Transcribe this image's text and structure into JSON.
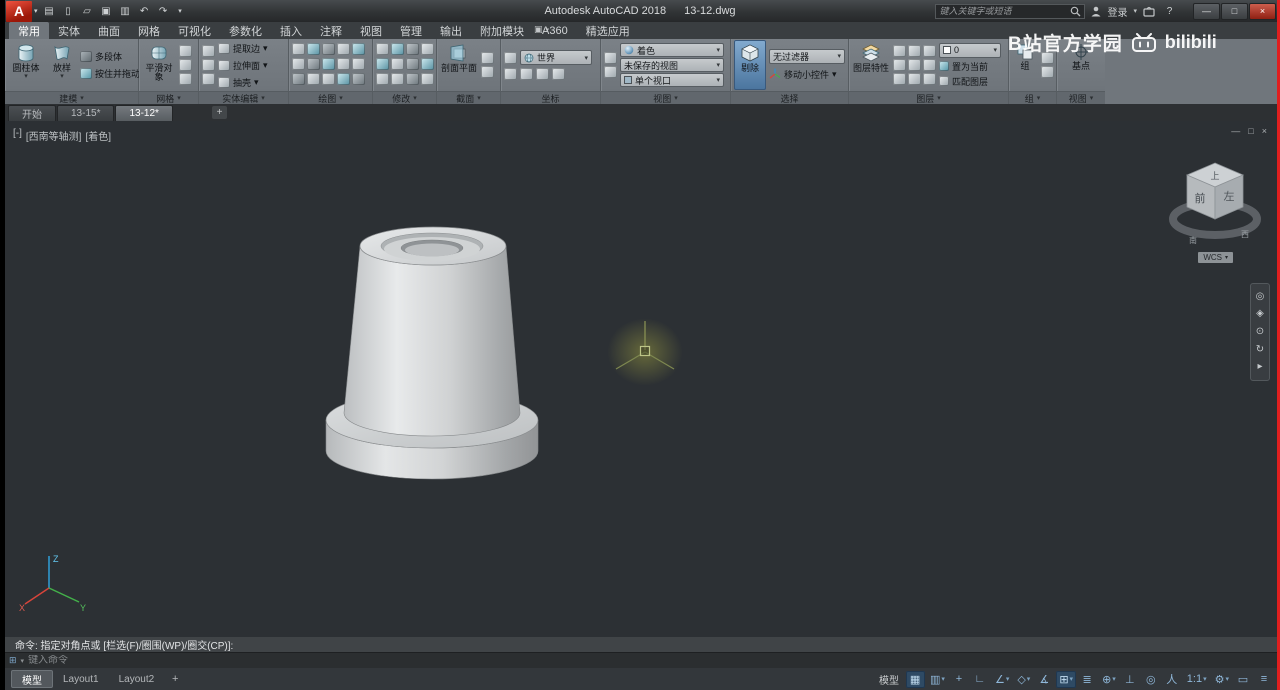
{
  "ui": {
    "flyout_arrow": "▾",
    "logo_letter": "A"
  },
  "title_bar": {
    "app_title": "Autodesk AutoCAD 2018",
    "doc_title": "13-12.dwg",
    "qat": [
      {
        "name": "workspace",
        "glyph": "▤"
      },
      {
        "name": "new-file",
        "glyph": "▯"
      },
      {
        "name": "open-file",
        "glyph": "▱"
      },
      {
        "name": "save-file",
        "glyph": "▣"
      },
      {
        "name": "plot",
        "glyph": "▥"
      },
      {
        "name": "undo",
        "glyph": "↶"
      },
      {
        "name": "redo",
        "glyph": "↷"
      }
    ],
    "search_placeholder": "键入关键字或短语",
    "signin_label": "登录",
    "help_label": "?",
    "window": {
      "minimize": "—",
      "restore": "□",
      "close": "×"
    }
  },
  "watermark": {
    "text": "B站官方学园",
    "brand": "bilibili"
  },
  "ribbon": {
    "toggle_glyph": "▣",
    "tabs": [
      {
        "label": "常用",
        "active": true
      },
      {
        "label": "实体"
      },
      {
        "label": "曲面"
      },
      {
        "label": "网格"
      },
      {
        "label": "可视化"
      },
      {
        "label": "参数化"
      },
      {
        "label": "插入"
      },
      {
        "label": "注释"
      },
      {
        "label": "视图"
      },
      {
        "label": "管理"
      },
      {
        "label": "输出"
      },
      {
        "label": "附加模块"
      },
      {
        "label": "A360"
      },
      {
        "label": "精选应用"
      }
    ],
    "panels": {
      "modeling": {
        "label": "建模",
        "cylinder": "圆柱体",
        "loft": "放样",
        "polysolid": "多段体",
        "presspull": "按住并拖动"
      },
      "mesh": {
        "label": "网格",
        "smooth_object": "平滑对象"
      },
      "solid_editing": {
        "label": "实体编辑",
        "rows": [
          {
            "label": "提取边"
          },
          {
            "label": "拉伸面"
          },
          {
            "label": "抽壳"
          }
        ]
      },
      "draw": {
        "label": "绘图",
        "tools": [
          {
            "name": "line"
          },
          {
            "name": "polyline"
          },
          {
            "name": "circle"
          },
          {
            "name": "arc"
          },
          {
            "name": "rectangle"
          },
          {
            "name": "ellipse"
          },
          {
            "name": "hatch"
          },
          {
            "name": "spline"
          },
          {
            "name": "point"
          },
          {
            "name": "region"
          },
          {
            "name": "helix"
          },
          {
            "name": "donut"
          },
          {
            "name": "revision-cloud"
          },
          {
            "name": "construction-line"
          },
          {
            "name": "multiline"
          }
        ]
      },
      "modify": {
        "label": "修改",
        "tools": [
          {
            "name": "move"
          },
          {
            "name": "rotate"
          },
          {
            "name": "trim"
          },
          {
            "name": "copy"
          },
          {
            "name": "mirror"
          },
          {
            "name": "fillet"
          },
          {
            "name": "erase"
          },
          {
            "name": "stretch"
          },
          {
            "name": "scale"
          },
          {
            "name": "array"
          },
          {
            "name": "offset"
          },
          {
            "name": "explode"
          }
        ]
      },
      "section": {
        "label": "截面",
        "section_plane": "剖面平面"
      },
      "coordinates": {
        "label": "坐标",
        "ucs_current": "世界"
      },
      "view_controls": {
        "label": "视图",
        "visual_style": "着色",
        "named_view": "未保存的视图",
        "viewport_config": "单个视口"
      },
      "selection": {
        "label": "选择",
        "culling": "剔除",
        "filter": "无过滤器",
        "gizmo": "移动小控件"
      },
      "layers": {
        "label": "图层",
        "layer_properties": "图层特性",
        "current_layer": "0",
        "make_current": "置为当前",
        "match_layer": "匹配图层"
      },
      "groups": {
        "label": "组",
        "group": "组"
      },
      "view_tail": {
        "label": "视图",
        "base_point": "基点"
      }
    }
  },
  "file_tabs": {
    "tabs": [
      {
        "label": "开始"
      },
      {
        "label": "13-15*"
      },
      {
        "label": "13-12*",
        "active": true
      }
    ],
    "add_tab": "+"
  },
  "viewport": {
    "corner": {
      "controls": "[-]",
      "view": "[西南等轴测]",
      "visual_style": "[着色]"
    },
    "viewcube": {
      "top": "上",
      "front": "前",
      "side": "左",
      "wcs": "WCS",
      "compass_south": "南",
      "compass_west": "西"
    },
    "window": {
      "minimize": "—",
      "restore": "□",
      "close": "×"
    },
    "navbar": [
      {
        "name": "full-navigation-wheel",
        "glyph": "◎"
      },
      {
        "name": "pan",
        "glyph": "◈"
      },
      {
        "name": "zoom",
        "glyph": "⊙"
      },
      {
        "name": "orbit",
        "glyph": "↻"
      },
      {
        "name": "showmotion",
        "glyph": "▸"
      }
    ],
    "ucs": {
      "x": "X",
      "y": "Y",
      "z": "Z"
    }
  },
  "command": {
    "history": "命令: 指定对角点或 [栏选(F)/圈围(WP)/圈交(CP)]:",
    "placeholder": "键入命令",
    "dock_icon": "⊞",
    "dock_arrow": "▾"
  },
  "layout_tabs": {
    "tabs": [
      {
        "label": "模型",
        "active": true
      },
      {
        "label": "Layout1"
      },
      {
        "label": "Layout2"
      }
    ],
    "add_tab": "+"
  },
  "status_bar": {
    "model_label": "模型",
    "items": [
      {
        "name": "grid-display",
        "glyph": "▦",
        "active": true
      },
      {
        "name": "snap-mode",
        "glyph": "▥",
        "arrow": "▾"
      },
      {
        "name": "dynamic-input",
        "glyph": "+"
      },
      {
        "name": "ortho-mode",
        "glyph": "∟"
      },
      {
        "name": "polar-tracking",
        "glyph": "∠",
        "arrow": "▾"
      },
      {
        "name": "isometric-drafting",
        "glyph": "◇",
        "arrow": "▾"
      },
      {
        "name": "object-snap-tracking",
        "glyph": "∡"
      },
      {
        "name": "object-snap",
        "glyph": "⊞",
        "active": true,
        "arrow": "▾"
      },
      {
        "name": "lineweight",
        "glyph": "≣"
      },
      {
        "name": "3d-object-snap",
        "glyph": "⊕",
        "arrow": "▾"
      },
      {
        "name": "dynamic-ucs",
        "glyph": "⊥"
      },
      {
        "name": "selection-cycling",
        "glyph": "◎"
      },
      {
        "name": "annotation-visibility",
        "glyph": "人"
      },
      {
        "name": "annotation-scale",
        "glyph": "1:1",
        "arrow": "▾"
      },
      {
        "name": "workspace-switching",
        "glyph": "⚙",
        "arrow": "▾"
      },
      {
        "name": "clean-screen",
        "glyph": "▭"
      },
      {
        "name": "customize",
        "glyph": "≡"
      }
    ]
  }
}
